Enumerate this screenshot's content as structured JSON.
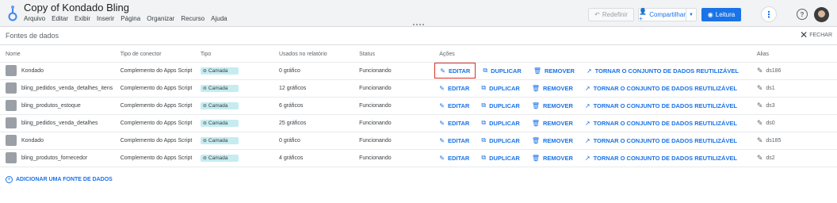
{
  "app": {
    "doc_title": "Copy of Kondado Bling",
    "menu": [
      "Arquivo",
      "Editar",
      "Exibir",
      "Inserir",
      "Página",
      "Organizar",
      "Recurso",
      "Ajuda"
    ]
  },
  "toolbar": {
    "redefinir": "Redefinir",
    "compartilhar": "Compartilhar",
    "leitura": "Leitura"
  },
  "panel": {
    "title": "Fontes de dados",
    "close": "FECHAR"
  },
  "table": {
    "headers": {
      "name": "Nome",
      "connector": "Tipo de conector",
      "type": "Tipo",
      "usage": "Usados no relatório",
      "status": "Status",
      "actions": "Ações",
      "alias": "Alias"
    },
    "actions": {
      "edit": "EDITAR",
      "duplicate": "DUPLICAR",
      "remove": "REMOVER",
      "reuse": "TORNAR O CONJUNTO DE DADOS REUTILIZÁVEL"
    },
    "rows": [
      {
        "name": "Kondado",
        "connector": "Complemento do Apps Script",
        "type": "Camada",
        "usage": "0 gráfico",
        "status": "Funcionando",
        "alias": "ds186"
      },
      {
        "name": "bling_pedidos_venda_detalhes_itens",
        "connector": "Complemento do Apps Script",
        "type": "Camada",
        "usage": "12 gráficos",
        "status": "Funcionando",
        "alias": "ds1"
      },
      {
        "name": "bling_produtos_estoque",
        "connector": "Complemento do Apps Script",
        "type": "Camada",
        "usage": "6 gráficos",
        "status": "Funcionando",
        "alias": "ds3"
      },
      {
        "name": "bling_pedidos_venda_detalhes",
        "connector": "Complemento do Apps Script",
        "type": "Camada",
        "usage": "25 gráficos",
        "status": "Funcionando",
        "alias": "ds0"
      },
      {
        "name": "Kondado",
        "connector": "Complemento do Apps Script",
        "type": "Camada",
        "usage": "0 gráfico",
        "status": "Funcionando",
        "alias": "ds185"
      },
      {
        "name": "bling_produtos_fornecedor",
        "connector": "Complemento do Apps Script",
        "type": "Camada",
        "usage": "4 gráficos",
        "status": "Funcionando",
        "alias": "ds2"
      }
    ]
  },
  "add_source": "ADICIONAR UMA FONTE DE DADOS",
  "colors": {
    "accent": "#1a73e8",
    "chip": "#c6ecf0",
    "highlight": "#d93025"
  }
}
